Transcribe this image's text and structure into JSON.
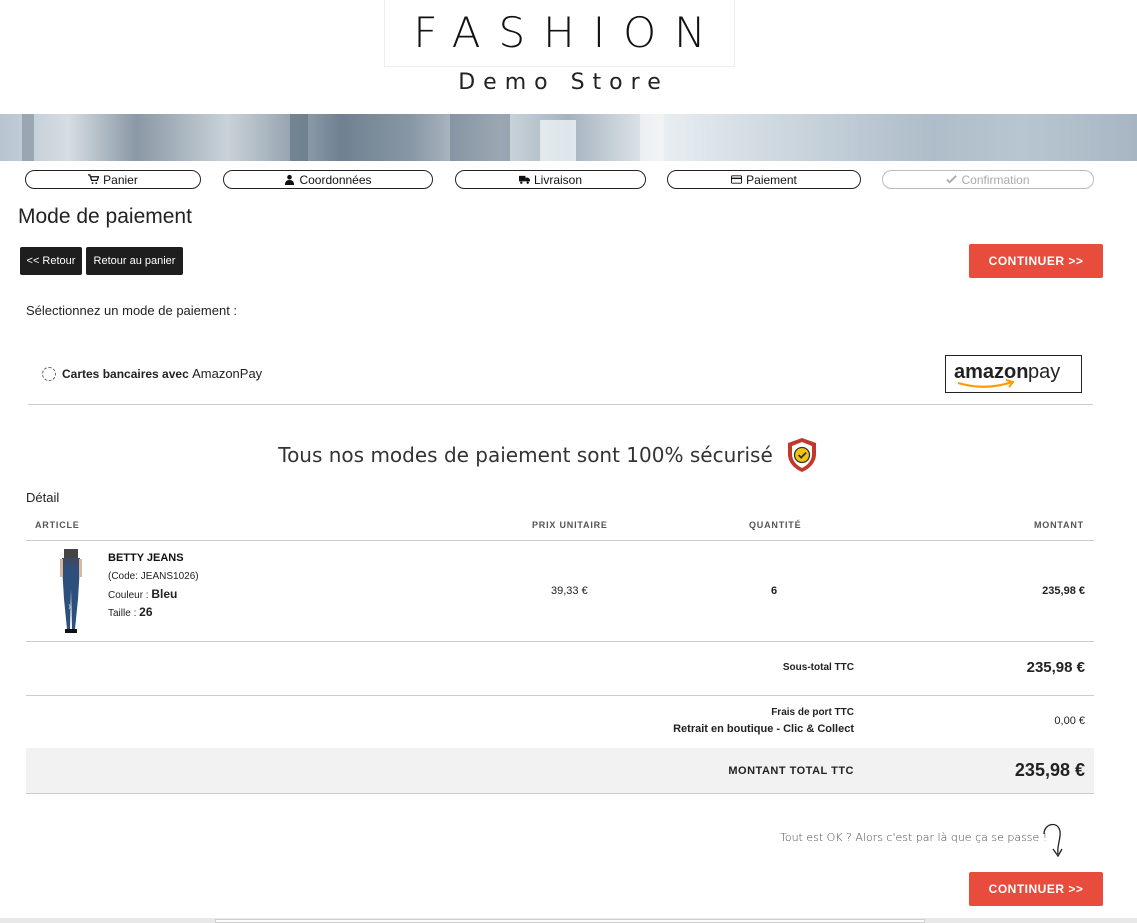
{
  "header": {
    "logo_title": "FASHION",
    "logo_subtitle": "Demo Store"
  },
  "steps": [
    {
      "label": "Panier",
      "icon": "cart-icon",
      "state": "done"
    },
    {
      "label": "Coordonnées",
      "icon": "user-icon",
      "state": "done"
    },
    {
      "label": "Livraison",
      "icon": "truck-icon",
      "state": "done"
    },
    {
      "label": "Paiement",
      "icon": "credit-card-icon",
      "state": "current"
    },
    {
      "label": "Confirmation",
      "icon": "check-icon",
      "state": "disabled"
    }
  ],
  "page_title": "Mode de paiement",
  "buttons": {
    "back": "<< Retour",
    "back_to_cart": "Retour au panier",
    "continue": "CONTINUER >>"
  },
  "payment": {
    "select_label": "Sélectionnez un mode de paiement :",
    "option_label_bold": "Cartes bancaires avec",
    "option_label_light": "AmazonPay",
    "option_selected": false,
    "logo_text_1": "amazon",
    "logo_text_2": "pay"
  },
  "secure_text": "Tous nos modes de paiement sont 100% sécurisé",
  "detail": {
    "label": "Détail",
    "columns": [
      "ARTICLE",
      "PRIX UNITAIRE",
      "QUANTITÉ",
      "MONTANT"
    ],
    "item": {
      "name": "BETTY JEANS",
      "code": "(Code: JEANS1026)",
      "color_label": "Couleur :",
      "color_value": "Bleu",
      "size_label": "Taille :",
      "size_value": "26",
      "unit_price": "39,33 €",
      "quantity": "6",
      "amount": "235,98 €"
    },
    "subtotal_label": "Sous-total TTC",
    "subtotal_value": "235,98 €",
    "shipping_label": "Frais de port TTC",
    "shipping_method": "Retrait en boutique - Clic & Collect",
    "shipping_value": "0,00 €",
    "total_label": "MONTANT TOTAL TTC",
    "total_value": "235,98 €"
  },
  "hint": "Tout est OK ? Alors c'est par là que ça se passe !",
  "colors": {
    "accent": "#e74c3c",
    "dark_button": "#1e1e1e",
    "shield": "#c0392b"
  }
}
